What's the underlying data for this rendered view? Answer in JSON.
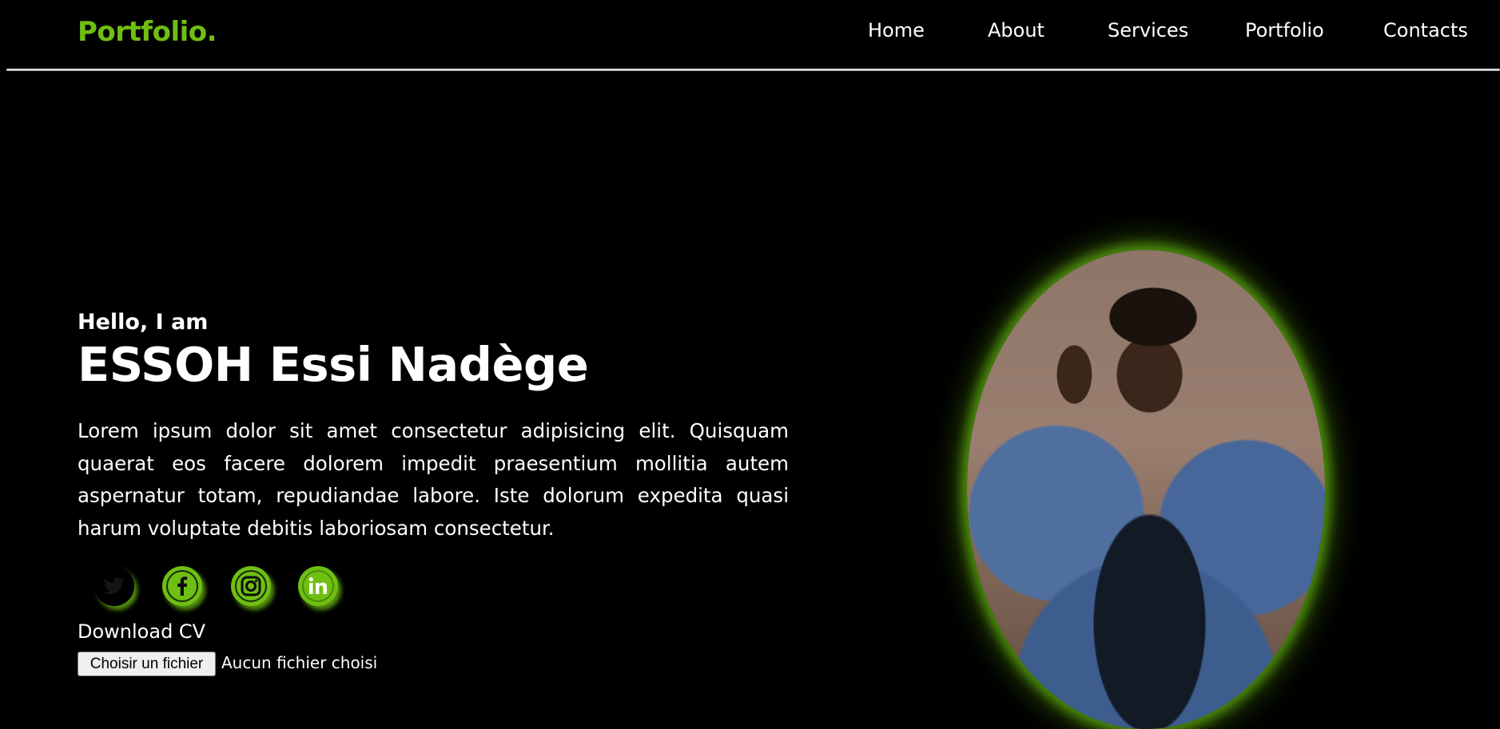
{
  "brand": {
    "logo": "Portfolio."
  },
  "nav": {
    "links": [
      {
        "label": "Home"
      },
      {
        "label": "About"
      },
      {
        "label": "Services"
      },
      {
        "label": "Portfolio"
      },
      {
        "label": "Contacts"
      }
    ]
  },
  "hero": {
    "greeting": "Hello, I am",
    "name": "ESSOH Essi Nadège",
    "bio": "Lorem ipsum dolor sit amet consectetur adipisicing elit. Quisquam quaerat eos facere dolorem impedit praesentium mollitia autem aspernatur totam, repudiandae labore. Iste dolorum expedita quasi harum voluptate debitis laboriosam consectetur."
  },
  "socials": [
    {
      "icon": "twitter-icon"
    },
    {
      "icon": "facebook-icon"
    },
    {
      "icon": "instagram-icon"
    },
    {
      "icon": "linkedin-icon"
    }
  ],
  "download": {
    "label": "Download CV",
    "file_button": "Choisir un fichier",
    "file_status": "Aucun fichier choisi"
  },
  "colors": {
    "accent": "#6fbf12",
    "background": "#000000",
    "text": "#ffffff"
  }
}
